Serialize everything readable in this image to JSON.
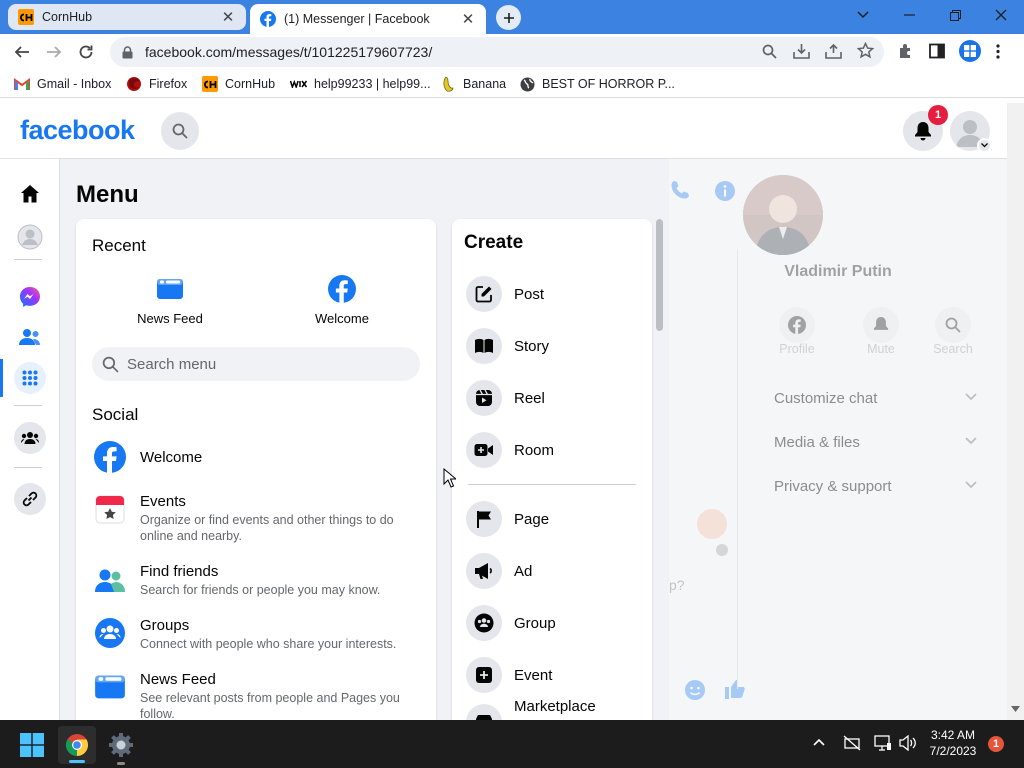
{
  "browser": {
    "tabs": [
      {
        "title": "CornHub",
        "active": false
      },
      {
        "title": "(1) Messenger | Facebook",
        "active": true
      }
    ],
    "url": "facebook.com/messages/t/101225179607723/",
    "bookmarks": [
      {
        "label": "Gmail - Inbox",
        "icon": "gmail-icon"
      },
      {
        "label": "Firefox",
        "icon": "firefox-icon"
      },
      {
        "label": "CornHub",
        "icon": "cornhub-icon"
      },
      {
        "label": "help99233 | help99...",
        "icon": "wix-icon"
      },
      {
        "label": "Banana",
        "icon": "banana-icon"
      },
      {
        "label": "BEST OF HORROR P...",
        "icon": "globe-icon"
      }
    ],
    "favicon_text": {
      "cornhub": "CH",
      "wix": "WIX"
    }
  },
  "facebook": {
    "logo": "facebook",
    "brand_color": "#1877f2",
    "notification_count": "1",
    "menu": {
      "title": "Menu",
      "recent": {
        "heading": "Recent",
        "items": [
          {
            "label": "News Feed"
          },
          {
            "label": "Welcome"
          }
        ]
      },
      "search_placeholder": "Search menu",
      "social": {
        "heading": "Social",
        "items": [
          {
            "label": "Welcome",
            "desc": ""
          },
          {
            "label": "Events",
            "desc": "Organize or find events and other things to do online and nearby."
          },
          {
            "label": "Find friends",
            "desc": "Search for friends or people you may know."
          },
          {
            "label": "Groups",
            "desc": "Connect with people who share your interests."
          },
          {
            "label": "News Feed",
            "desc": "See relevant posts from people and Pages you follow."
          }
        ]
      },
      "create": {
        "heading": "Create",
        "items": [
          {
            "label": "Post"
          },
          {
            "label": "Story"
          },
          {
            "label": "Reel"
          },
          {
            "label": "Room"
          },
          {
            "label": "Page"
          },
          {
            "label": "Ad"
          },
          {
            "label": "Group"
          },
          {
            "label": "Event"
          },
          {
            "label": "Marketplace"
          }
        ]
      }
    },
    "chat_panel": {
      "name": "Vladimir Putin",
      "actions": [
        {
          "label": "Profile"
        },
        {
          "label": "Mute"
        },
        {
          "label": "Search"
        }
      ],
      "sections": [
        {
          "label": "Customize chat"
        },
        {
          "label": "Media & files"
        },
        {
          "label": "Privacy & support"
        }
      ],
      "partial_text": "p?"
    }
  },
  "taskbar": {
    "time": "3:42 AM",
    "date": "7/2/2023",
    "notification_count": "1"
  }
}
